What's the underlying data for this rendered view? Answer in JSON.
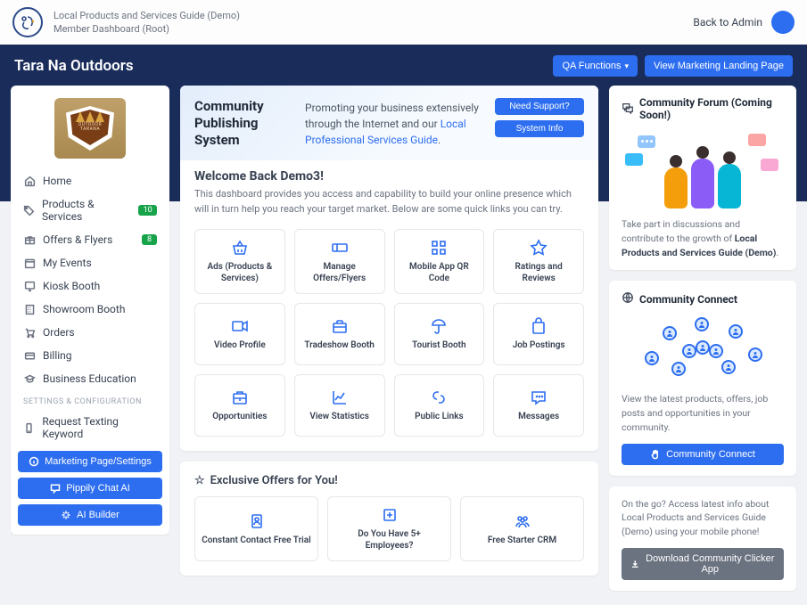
{
  "topbar": {
    "title_line1": "Local Products and Services Guide (Demo)",
    "title_line2": "Member Dashboard (Root)",
    "back_link": "Back to Admin"
  },
  "brand": {
    "name": "Tara Na Outdoors",
    "qa_button": "QA Functions",
    "landing_button": "View Marketing Landing Page",
    "logo_text1": "OUTDOOR",
    "logo_text2": "TARANA"
  },
  "sidebar": {
    "items": [
      {
        "label": "Home",
        "icon": "home"
      },
      {
        "label": "Products & Services",
        "icon": "tag",
        "badge": "10"
      },
      {
        "label": "Offers & Flyers",
        "icon": "gift",
        "badge": "8"
      },
      {
        "label": "My Events",
        "icon": "calendar"
      },
      {
        "label": "Kiosk Booth",
        "icon": "monitor"
      },
      {
        "label": "Showroom Booth",
        "icon": "building"
      },
      {
        "label": "Orders",
        "icon": "cart"
      },
      {
        "label": "Billing",
        "icon": "card"
      },
      {
        "label": "Business Education",
        "icon": "grad"
      }
    ],
    "section_header": "SETTINGS & CONFIGURATION",
    "config_items": [
      {
        "label": "Request Texting Keyword",
        "icon": "phone"
      }
    ],
    "actions": [
      {
        "label": "Marketing Page/Settings",
        "icon": "info"
      },
      {
        "label": "Pippily Chat AI",
        "icon": "chat"
      },
      {
        "label": "AI Builder",
        "icon": "sparkle"
      }
    ]
  },
  "hero": {
    "title": "Community Publishing System",
    "text_before_link": "Promoting your business extensively through the Internet and our ",
    "link_text": "Local Professional Services Guide",
    "support_btn": "Need Support?",
    "info_btn": "System Info"
  },
  "welcome": {
    "greeting": "Welcome Back Demo3!",
    "subtext": "This dashboard provides you access and capability to build your online presence which will in turn help you reach your target market. Below are some quick links you can try."
  },
  "tiles": [
    {
      "label": "Ads (Products & Services)",
      "icon": "basket"
    },
    {
      "label": "Manage Offers/Flyers",
      "icon": "ticket"
    },
    {
      "label": "Mobile App QR Code",
      "icon": "qr"
    },
    {
      "label": "Ratings and Reviews",
      "icon": "star"
    },
    {
      "label": "Video Profile",
      "icon": "video"
    },
    {
      "label": "Tradeshow Booth",
      "icon": "briefcase"
    },
    {
      "label": "Tourist Booth",
      "icon": "umbrella"
    },
    {
      "label": "Job Postings",
      "icon": "bag"
    },
    {
      "label": "Opportunities",
      "icon": "case"
    },
    {
      "label": "View Statistics",
      "icon": "chart"
    },
    {
      "label": "Public Links",
      "icon": "link"
    },
    {
      "label": "Messages",
      "icon": "message"
    }
  ],
  "offers": {
    "title": "Exclusive Offers for You!",
    "items": [
      {
        "label": "Constant Contact Free Trial",
        "icon": "contact"
      },
      {
        "label": "Do You Have 5+ Employees?",
        "icon": "plus"
      },
      {
        "label": "Free Starter CRM",
        "icon": "people"
      }
    ]
  },
  "forum": {
    "title": "Community Forum (Coming Soon!)",
    "text_before": "Take part in discussions and contribute to the growth of ",
    "text_bold": "Local Products and Services Guide (Demo)",
    "text_after": "."
  },
  "connect": {
    "title": "Community Connect",
    "text": "View the latest products, offers, job posts and opportunities in your community.",
    "button": "Community Connect"
  },
  "mobile": {
    "text": "On the go? Access latest info about Local Products and Services Guide (Demo) using your mobile phone!",
    "button": "Download Community Clicker App"
  }
}
